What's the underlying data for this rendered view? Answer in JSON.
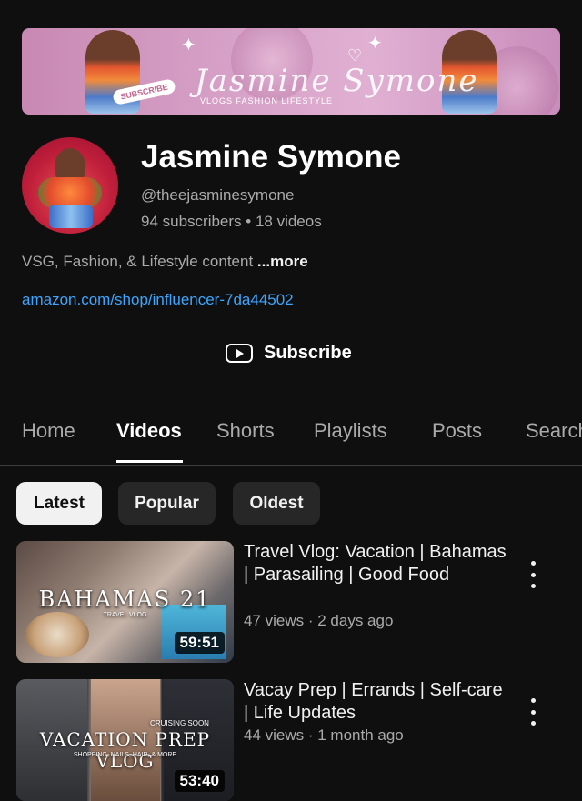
{
  "channel": {
    "banner_script": "Jasmine Symone",
    "banner_tagline": "VLOGS  FASHION  LIFESTYLE",
    "banner_subscribe": "SUBSCRIBE",
    "name": "Jasmine Symone",
    "handle": "@theejasminesymone",
    "stats": "94 subscribers • 18 videos",
    "description": "VSG, Fashion, & Lifestyle content ",
    "more_label": "...more",
    "link": "amazon.com/shop/influencer-7da44502",
    "subscribe_label": "Subscribe"
  },
  "tabs": [
    {
      "label": "Home",
      "active": false
    },
    {
      "label": "Videos",
      "active": true
    },
    {
      "label": "Shorts",
      "active": false
    },
    {
      "label": "Playlists",
      "active": false
    },
    {
      "label": "Posts",
      "active": false
    },
    {
      "label": "Search",
      "active": false
    }
  ],
  "filters": [
    {
      "label": "Latest",
      "selected": true
    },
    {
      "label": "Popular",
      "selected": false
    },
    {
      "label": "Oldest",
      "selected": false
    }
  ],
  "videos": [
    {
      "thumb_title": "BAHAMAS 21",
      "thumb_subtitle": "TRAVEL VLOG",
      "title": "Travel Vlog: Vacation | Bahamas | Parasailing | Good Food",
      "meta": "47 views · 2 days ago",
      "duration": "59:51"
    },
    {
      "thumb_title": "VACATION PREP VLOG",
      "thumb_subtitle": "SHOPPING, NAILS, HAIR, & MORE",
      "thumb_extra": "CRUISING SOON",
      "title": "Vacay Prep | Errands | Self-care | Life Updates",
      "meta": "44 views · 1 month ago",
      "duration": "53:40"
    }
  ],
  "colors": {
    "background": "#0f0f0f",
    "link": "#3ea6ff",
    "banner_pink": "#d7a2c8",
    "avatar_red": "#c01f3b"
  },
  "icons": [
    "youtube-icon",
    "more-vert-icon"
  ]
}
